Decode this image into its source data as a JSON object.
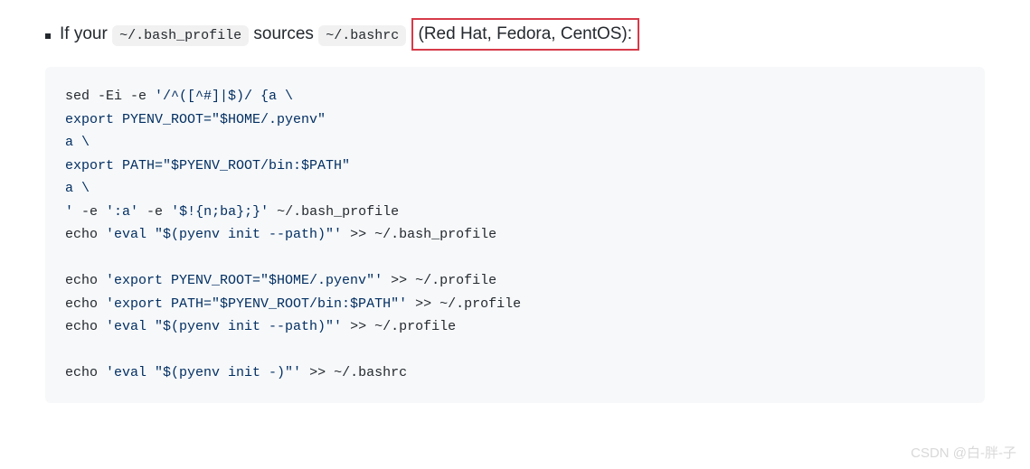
{
  "intro": {
    "prefix": "If your ",
    "code1": "~/.bash_profile",
    "middle": " sources ",
    "code2": "~/.bashrc",
    "highlight": "(Red Hat, Fedora, CentOS):"
  },
  "code": {
    "line1a": "sed -Ei -e ",
    "line1b": "'/^([^#]|$)/ {a \\",
    "line2": "export PYENV_ROOT=\"$HOME/.pyenv\"",
    "line3": "a \\",
    "line4": "export PATH=\"$PYENV_ROOT/bin:$PATH\"",
    "line5": "a \\",
    "line6a": "'",
    "line6b": " -e ",
    "line6c": "':a'",
    "line6d": " -e ",
    "line6e": "'$!{n;ba};}'",
    "line6f": " ~/.bash_profile",
    "line7a": "echo ",
    "line7b": "'eval \"$(pyenv init --path)\"'",
    "line7c": " >> ~/.bash_profile",
    "line8a": "echo ",
    "line8b": "'export PYENV_ROOT=\"$HOME/.pyenv\"'",
    "line8c": " >> ~/.profile",
    "line9a": "echo ",
    "line9b": "'export PATH=\"$PYENV_ROOT/bin:$PATH\"'",
    "line9c": " >> ~/.profile",
    "line10a": "echo ",
    "line10b": "'eval \"$(pyenv init --path)\"'",
    "line10c": " >> ~/.profile",
    "line11a": "echo ",
    "line11b": "'eval \"$(pyenv init -)\"'",
    "line11c": " >> ~/.bashrc"
  },
  "watermark": "CSDN @白-胖-子"
}
